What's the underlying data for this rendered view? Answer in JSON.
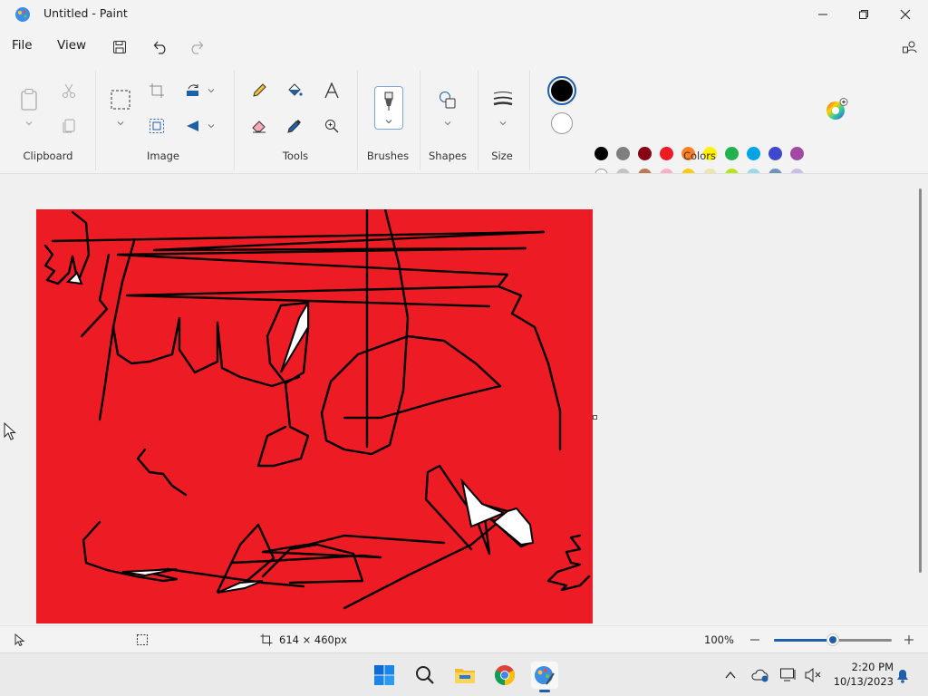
{
  "window": {
    "title": "Untitled - Paint"
  },
  "menu": {
    "file": "File",
    "view": "View"
  },
  "ribbon": {
    "groups": {
      "clipboard": "Clipboard",
      "image": "Image",
      "tools": "Tools",
      "brushes": "Brushes",
      "shapes": "Shapes",
      "size": "Size",
      "colors": "Colors"
    },
    "primary_color": "#000000",
    "secondary_color": "#ffffff",
    "palette_row1": [
      "#000000",
      "#7f7f7f",
      "#880015",
      "#ed1c24",
      "#ff7f27",
      "#fff200",
      "#22b14c",
      "#00a2e8",
      "#3f48cc",
      "#a349a4"
    ],
    "palette_row2": [
      "#ffffff",
      "#c3c3c3",
      "#b97a57",
      "#ffaec9",
      "#ffc90e",
      "#efe4b0",
      "#b5e61d",
      "#99d9ea",
      "#7092be",
      "#c8bfe7"
    ],
    "palette_row3_empty": 10
  },
  "canvas": {
    "background": "#ed1c24"
  },
  "status": {
    "canvas_size": "614 × 460px",
    "zoom": "100%",
    "zoom_fraction": 0.5
  },
  "taskbar": {
    "time": "2:20 PM",
    "date": "10/13/2023"
  }
}
